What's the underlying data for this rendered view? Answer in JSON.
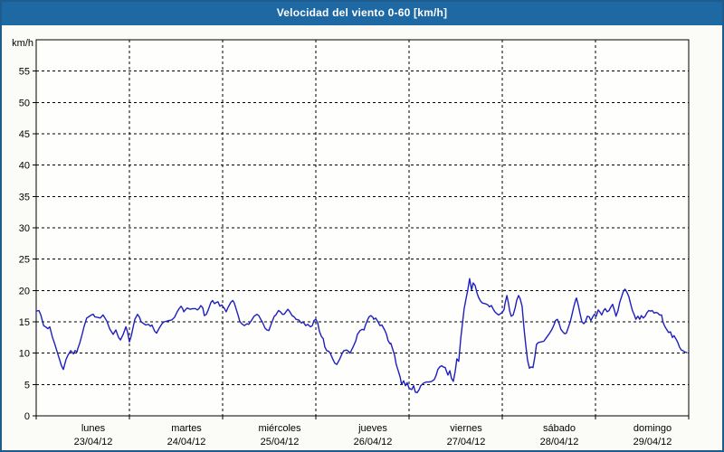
{
  "window": {
    "title": "Velocidad del viento 0-60 [km/h]",
    "title_bar_color": "#1e69a4",
    "border_color": "#1d5c8d"
  },
  "chart_data": {
    "type": "line",
    "title": "Velocidad del viento 0-60 [km/h]",
    "ylabel": "km/h",
    "unit_label": "km/h",
    "grid": "dashed",
    "legend": "none",
    "line_color": "#1f1fbe",
    "y_axis": {
      "min": 0,
      "max": 60,
      "step": 5,
      "tick_labels": [
        "0",
        "5",
        "10",
        "15",
        "20",
        "25",
        "30",
        "35",
        "40",
        "45",
        "50",
        "55"
      ]
    },
    "x_axis": {
      "hours_total": 168,
      "days": [
        {
          "name": "lunes",
          "date": "23/04/12"
        },
        {
          "name": "martes",
          "date": "24/04/12"
        },
        {
          "name": "miércoles",
          "date": "25/04/12"
        },
        {
          "name": "jueves",
          "date": "26/04/12"
        },
        {
          "name": "viernes",
          "date": "27/04/12"
        },
        {
          "name": "sábado",
          "date": "28/04/12"
        },
        {
          "name": "domingo",
          "date": "29/04/12"
        }
      ]
    },
    "points": [
      [
        0,
        16.7
      ],
      [
        0.7,
        16.8
      ],
      [
        1.2,
        16.1
      ],
      [
        1.9,
        14.4
      ],
      [
        2.6,
        14.1
      ],
      [
        3.0,
        13.9
      ],
      [
        3.5,
        14.2
      ],
      [
        4.2,
        12.5
      ],
      [
        4.7,
        11.6
      ],
      [
        5.4,
        10.2
      ],
      [
        5.8,
        9.4
      ],
      [
        6.5,
        8.0
      ],
      [
        7.0,
        7.4
      ],
      [
        7.7,
        9.0
      ],
      [
        8.2,
        9.7
      ],
      [
        8.9,
        10.4
      ],
      [
        9.6,
        9.9
      ],
      [
        10.0,
        10.4
      ],
      [
        10.5,
        10.2
      ],
      [
        10.7,
        10.7
      ],
      [
        11.2,
        11.6
      ],
      [
        11.9,
        13.2
      ],
      [
        12.3,
        14.2
      ],
      [
        13.0,
        15.6
      ],
      [
        13.5,
        15.8
      ],
      [
        14.2,
        16.1
      ],
      [
        14.7,
        16.2
      ],
      [
        15.1,
        15.8
      ],
      [
        15.8,
        15.7
      ],
      [
        16.5,
        15.6
      ],
      [
        17.2,
        16.1
      ],
      [
        17.7,
        15.6
      ],
      [
        18.2,
        15.1
      ],
      [
        18.9,
        13.9
      ],
      [
        19.3,
        13.5
      ],
      [
        19.8,
        13.0
      ],
      [
        20.5,
        13.7
      ],
      [
        21.2,
        12.5
      ],
      [
        21.7,
        12.1
      ],
      [
        22.4,
        13.0
      ],
      [
        23.1,
        14.2
      ],
      [
        23.5,
        13.4
      ],
      [
        24,
        11.8
      ],
      [
        24.5,
        12.8
      ],
      [
        24.9,
        14.0
      ],
      [
        25.4,
        15.4
      ],
      [
        26.1,
        16.2
      ],
      [
        26.6,
        15.7
      ],
      [
        27.0,
        15.0
      ],
      [
        27.7,
        14.7
      ],
      [
        28.2,
        14.5
      ],
      [
        28.9,
        14.6
      ],
      [
        29.4,
        14.3
      ],
      [
        29.8,
        14.5
      ],
      [
        30.5,
        13.5
      ],
      [
        31.0,
        13.2
      ],
      [
        31.7,
        14.0
      ],
      [
        32.4,
        14.7
      ],
      [
        32.9,
        15.0
      ],
      [
        33.6,
        15.1
      ],
      [
        34.2,
        15.2
      ],
      [
        34.9,
        15.3
      ],
      [
        35.6,
        15.7
      ],
      [
        36.3,
        16.6
      ],
      [
        36.8,
        17.1
      ],
      [
        37.3,
        17.5
      ],
      [
        37.7,
        17.1
      ],
      [
        38.0,
        16.6
      ],
      [
        38.4,
        16.9
      ],
      [
        38.9,
        17.2
      ],
      [
        39.6,
        17.0
      ],
      [
        40.3,
        17.1
      ],
      [
        41.0,
        17.1
      ],
      [
        41.5,
        16.9
      ],
      [
        41.9,
        17.1
      ],
      [
        42.4,
        17.6
      ],
      [
        42.9,
        17.2
      ],
      [
        43.3,
        16.0
      ],
      [
        43.8,
        16.2
      ],
      [
        44.3,
        16.9
      ],
      [
        45.0,
        18.1
      ],
      [
        45.4,
        18.4
      ],
      [
        45.9,
        17.9
      ],
      [
        46.4,
        18.1
      ],
      [
        46.8,
        18.2
      ],
      [
        47.3,
        17.5
      ],
      [
        47.8,
        17.7
      ],
      [
        48.5,
        17.1
      ],
      [
        48.9,
        16.6
      ],
      [
        49.4,
        17.3
      ],
      [
        50.1,
        18.1
      ],
      [
        50.6,
        18.4
      ],
      [
        51.0,
        18.0
      ],
      [
        51.5,
        17.0
      ],
      [
        52.0,
        16.0
      ],
      [
        52.4,
        15.1
      ],
      [
        52.9,
        14.7
      ],
      [
        53.6,
        14.4
      ],
      [
        54.3,
        14.7
      ],
      [
        54.7,
        14.6
      ],
      [
        55.4,
        15.2
      ],
      [
        56.1,
        15.9
      ],
      [
        56.8,
        16.2
      ],
      [
        57.3,
        16.0
      ],
      [
        57.8,
        15.4
      ],
      [
        58.2,
        15.0
      ],
      [
        58.9,
        14.0
      ],
      [
        59.4,
        13.7
      ],
      [
        59.9,
        13.6
      ],
      [
        60.3,
        14.3
      ],
      [
        60.8,
        15.1
      ],
      [
        61.3,
        15.9
      ],
      [
        61.7,
        16.1
      ],
      [
        62.4,
        16.8
      ],
      [
        62.9,
        16.6
      ],
      [
        63.4,
        16.2
      ],
      [
        63.8,
        16.2
      ],
      [
        64.3,
        16.6
      ],
      [
        64.8,
        17.0
      ],
      [
        65.2,
        16.7
      ],
      [
        65.9,
        16.0
      ],
      [
        66.4,
        15.8
      ],
      [
        66.9,
        15.4
      ],
      [
        67.6,
        15.3
      ],
      [
        68.3,
        14.8
      ],
      [
        68.7,
        15.0
      ],
      [
        69.4,
        14.4
      ],
      [
        69.9,
        14.6
      ],
      [
        70.6,
        14.2
      ],
      [
        71.1,
        14.4
      ],
      [
        71.5,
        15.2
      ],
      [
        72,
        15.4
      ],
      [
        72.5,
        14.8
      ],
      [
        72.9,
        13.5
      ],
      [
        73.4,
        12.7
      ],
      [
        73.9,
        12.3
      ],
      [
        74.3,
        11.0
      ],
      [
        74.8,
        10.4
      ],
      [
        75.3,
        10.3
      ],
      [
        75.7,
        10.0
      ],
      [
        76.4,
        9.0
      ],
      [
        76.9,
        8.4
      ],
      [
        77.4,
        8.2
      ],
      [
        78.1,
        9.0
      ],
      [
        78.8,
        10.0
      ],
      [
        79.2,
        10.4
      ],
      [
        79.9,
        10.5
      ],
      [
        80.4,
        10.3
      ],
      [
        80.8,
        10.0
      ],
      [
        81.6,
        11.0
      ],
      [
        82.3,
        12.0
      ],
      [
        82.7,
        13.0
      ],
      [
        83.4,
        13.6
      ],
      [
        83.9,
        13.8
      ],
      [
        84.4,
        13.7
      ],
      [
        84.8,
        14.5
      ],
      [
        85.3,
        15.3
      ],
      [
        85.7,
        15.8
      ],
      [
        86.2,
        16.0
      ],
      [
        86.7,
        15.7
      ],
      [
        86.9,
        15.4
      ],
      [
        87.4,
        15.6
      ],
      [
        88.1,
        14.9
      ],
      [
        88.5,
        14.4
      ],
      [
        89.0,
        14.5
      ],
      [
        89.7,
        13.7
      ],
      [
        90.2,
        13.0
      ],
      [
        90.6,
        12.0
      ],
      [
        91.1,
        11.5
      ],
      [
        91.3,
        11.6
      ],
      [
        91.8,
        10.6
      ],
      [
        92.3,
        9.6
      ],
      [
        92.7,
        8.2
      ],
      [
        93.2,
        7.2
      ],
      [
        93.7,
        6.2
      ],
      [
        94.1,
        5.0
      ],
      [
        94.6,
        5.6
      ],
      [
        95.1,
        4.8
      ],
      [
        95.5,
        5.3
      ],
      [
        96,
        4.4
      ],
      [
        96.7,
        4.2
      ],
      [
        97.2,
        4.8
      ],
      [
        97.6,
        3.8
      ],
      [
        98.1,
        3.7
      ],
      [
        98.6,
        4.2
      ],
      [
        99.0,
        4.8
      ],
      [
        99.7,
        5.2
      ],
      [
        100.4,
        5.4
      ],
      [
        101.1,
        5.4
      ],
      [
        101.8,
        5.5
      ],
      [
        102.5,
        5.8
      ],
      [
        103.0,
        6.5
      ],
      [
        103.4,
        7.4
      ],
      [
        103.9,
        7.8
      ],
      [
        104.4,
        8.0
      ],
      [
        104.8,
        7.8
      ],
      [
        105.3,
        7.7
      ],
      [
        106.0,
        6.5
      ],
      [
        106.5,
        7.2
      ],
      [
        106.9,
        6.0
      ],
      [
        107.4,
        5.5
      ],
      [
        107.9,
        7.2
      ],
      [
        108.3,
        9.1
      ],
      [
        108.8,
        8.7
      ],
      [
        109.3,
        12.3
      ],
      [
        109.7,
        14.5
      ],
      [
        110.2,
        17.1
      ],
      [
        110.7,
        18.8
      ],
      [
        111.1,
        20.0
      ],
      [
        111.6,
        21.9
      ],
      [
        112.1,
        20.1
      ],
      [
        112.5,
        21.2
      ],
      [
        113.0,
        20.8
      ],
      [
        113.5,
        19.6
      ],
      [
        113.9,
        18.9
      ],
      [
        114.4,
        18.3
      ],
      [
        114.9,
        18.0
      ],
      [
        115.6,
        17.9
      ],
      [
        116.3,
        17.7
      ],
      [
        116.7,
        17.4
      ],
      [
        117.2,
        17.6
      ],
      [
        117.7,
        17.0
      ],
      [
        118.1,
        16.6
      ],
      [
        118.6,
        16.3
      ],
      [
        119.1,
        16.1
      ],
      [
        119.5,
        16.3
      ],
      [
        120,
        16.5
      ],
      [
        120.5,
        17.0
      ],
      [
        120.7,
        17.9
      ],
      [
        121.2,
        19.2
      ],
      [
        121.6,
        17.9
      ],
      [
        121.9,
        16.7
      ],
      [
        122.3,
        15.9
      ],
      [
        122.8,
        16.1
      ],
      [
        123.3,
        17.2
      ],
      [
        123.7,
        18.4
      ],
      [
        124.2,
        19.2
      ],
      [
        124.6,
        18.7
      ],
      [
        125.1,
        17.5
      ],
      [
        125.6,
        14.0
      ],
      [
        126.0,
        11.5
      ],
      [
        126.5,
        8.9
      ],
      [
        127.0,
        7.6
      ],
      [
        127.4,
        7.8
      ],
      [
        127.9,
        7.7
      ],
      [
        128.4,
        9.5
      ],
      [
        128.8,
        11.4
      ],
      [
        129.3,
        11.7
      ],
      [
        130.0,
        11.8
      ],
      [
        130.7,
        11.9
      ],
      [
        131.4,
        12.5
      ],
      [
        132.1,
        13.1
      ],
      [
        132.8,
        13.8
      ],
      [
        133.3,
        14.5
      ],
      [
        133.7,
        15.2
      ],
      [
        134.2,
        15.4
      ],
      [
        134.7,
        14.6
      ],
      [
        135.1,
        13.8
      ],
      [
        135.6,
        13.4
      ],
      [
        136.1,
        13.1
      ],
      [
        136.5,
        13.2
      ],
      [
        137.0,
        14.1
      ],
      [
        137.5,
        15.0
      ],
      [
        137.9,
        16.0
      ],
      [
        138.4,
        17.4
      ],
      [
        138.9,
        18.5
      ],
      [
        139.1,
        18.8
      ],
      [
        139.6,
        17.6
      ],
      [
        140.0,
        16.4
      ],
      [
        140.5,
        15.0
      ],
      [
        141.0,
        14.7
      ],
      [
        141.4,
        15.0
      ],
      [
        141.9,
        15.9
      ],
      [
        142.4,
        15.8
      ],
      [
        142.8,
        15.2
      ],
      [
        143.3,
        15.8
      ],
      [
        143.7,
        16.2
      ],
      [
        144.2,
        15.9
      ],
      [
        144.7,
        16.9
      ],
      [
        145.1,
        16.6
      ],
      [
        145.6,
        16.1
      ],
      [
        146.1,
        16.8
      ],
      [
        146.5,
        17.1
      ],
      [
        147.0,
        16.6
      ],
      [
        147.5,
        16.8
      ],
      [
        147.9,
        17.3
      ],
      [
        148.4,
        17.8
      ],
      [
        148.9,
        16.8
      ],
      [
        149.3,
        15.9
      ],
      [
        149.8,
        16.8
      ],
      [
        150.2,
        18.0
      ],
      [
        150.7,
        19.0
      ],
      [
        151.2,
        19.9
      ],
      [
        151.6,
        20.2
      ],
      [
        152.1,
        19.7
      ],
      [
        152.6,
        19.0
      ],
      [
        153.0,
        18.0
      ],
      [
        153.5,
        16.8
      ],
      [
        154.0,
        16.1
      ],
      [
        154.4,
        15.4
      ],
      [
        154.9,
        15.9
      ],
      [
        155.4,
        15.4
      ],
      [
        155.8,
        16.0
      ],
      [
        156.3,
        15.6
      ],
      [
        156.8,
        15.9
      ],
      [
        157.2,
        16.4
      ],
      [
        157.7,
        16.8
      ],
      [
        158.2,
        16.7
      ],
      [
        158.6,
        16.8
      ],
      [
        159.1,
        16.4
      ],
      [
        159.6,
        16.5
      ],
      [
        160.0,
        16.4
      ],
      [
        160.5,
        16.1
      ],
      [
        161.0,
        16.1
      ],
      [
        161.4,
        14.9
      ],
      [
        161.9,
        14.2
      ],
      [
        162.4,
        13.7
      ],
      [
        162.8,
        13.3
      ],
      [
        163.3,
        13.4
      ],
      [
        163.8,
        12.5
      ],
      [
        164.2,
        12.8
      ],
      [
        164.7,
        12.3
      ],
      [
        165.2,
        11.7
      ],
      [
        165.6,
        11.0
      ],
      [
        166.1,
        10.5
      ],
      [
        166.5,
        10.4
      ],
      [
        167.0,
        10.2
      ],
      [
        167.5,
        10.1
      ]
    ]
  }
}
